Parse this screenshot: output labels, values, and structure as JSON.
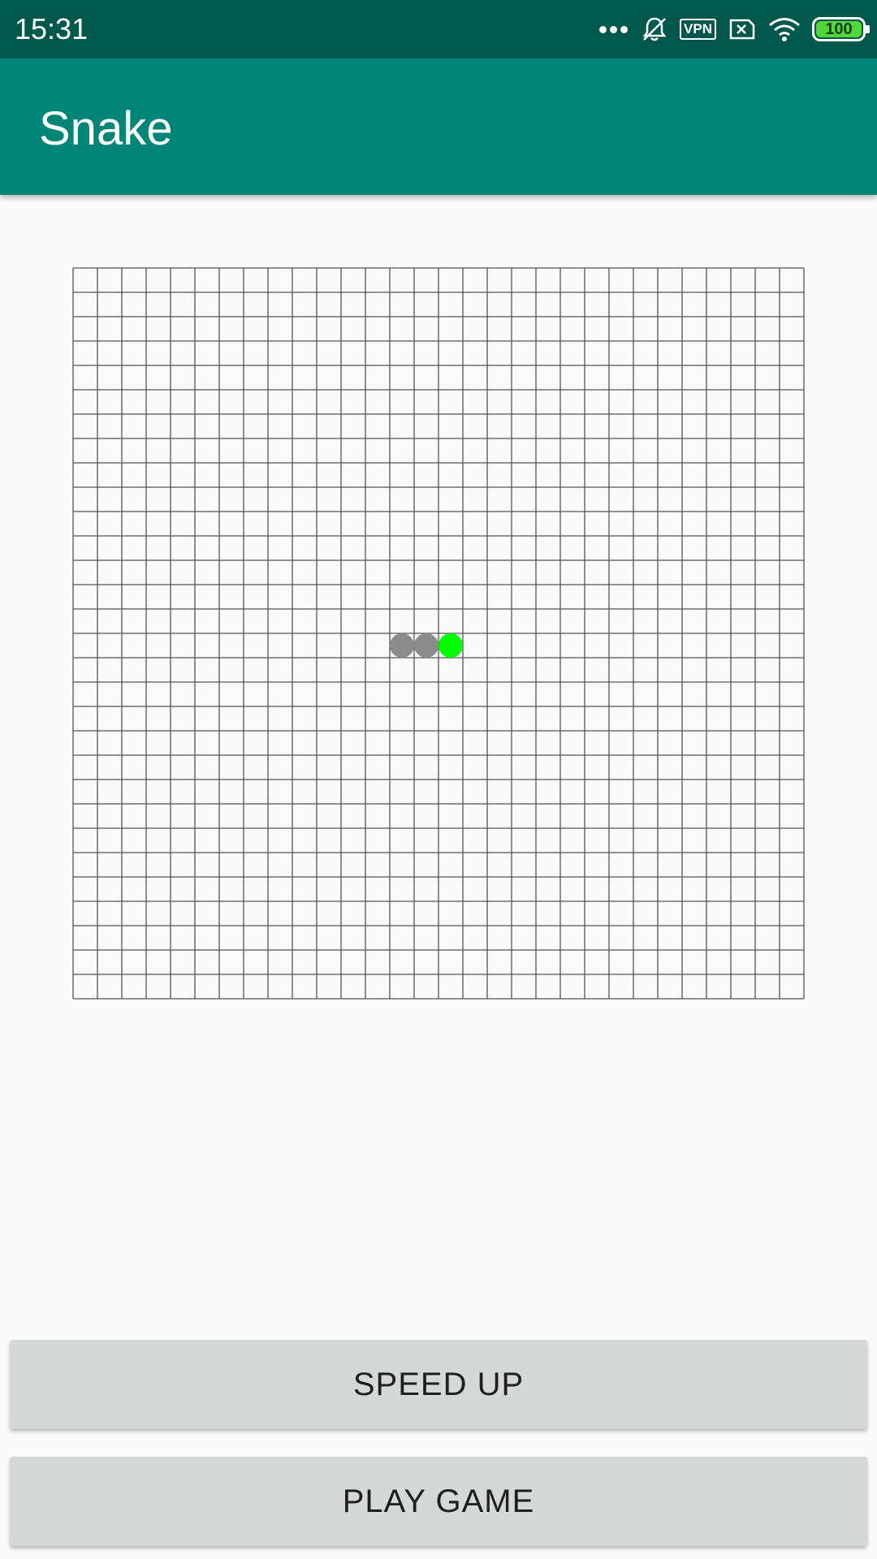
{
  "status_bar": {
    "time": "15:31",
    "vpn_label": "VPN",
    "battery_level": "100",
    "icons": [
      "more-dots-icon",
      "mute-bell-icon",
      "vpn-icon",
      "sim-x-icon",
      "wifi-icon",
      "battery-icon"
    ]
  },
  "app_bar": {
    "title": "Snake"
  },
  "game": {
    "grid": {
      "columns": 30,
      "rows": 30
    },
    "snake": {
      "body": [
        {
          "col": 13,
          "row": 15
        },
        {
          "col": 14,
          "row": 15
        }
      ],
      "head": {
        "col": 15,
        "row": 15
      },
      "body_color": "#8c8c8c",
      "head_color": "#00ff00"
    },
    "grid_line_color": "#555555"
  },
  "buttons": {
    "speed_up": "SPEED UP",
    "play_game": "PLAY GAME"
  },
  "colors": {
    "status_bar": "#00574b",
    "app_bar": "#008577",
    "background": "#fafafa",
    "button": "#d6d7d7"
  }
}
